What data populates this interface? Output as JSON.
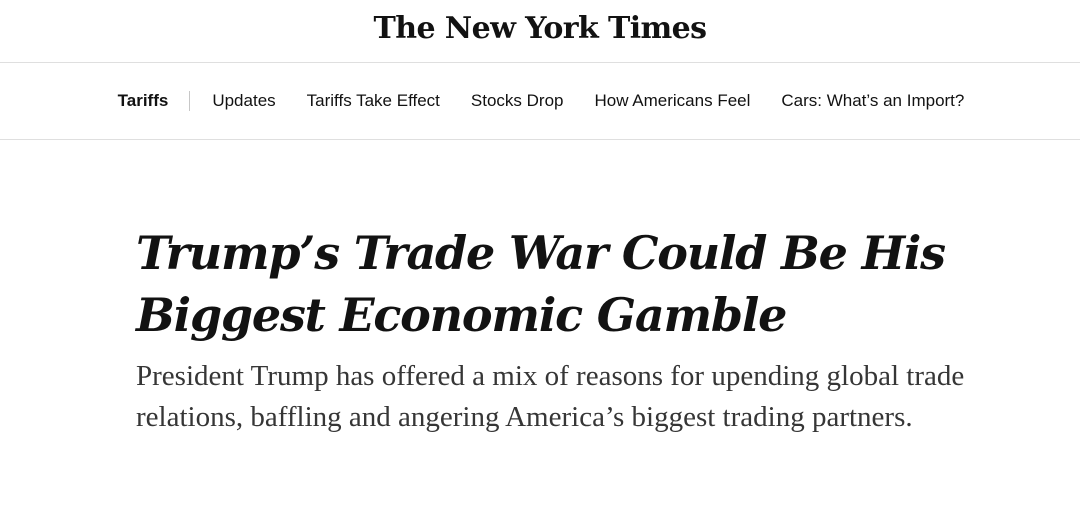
{
  "masthead": {
    "logo_text": "The New York Times"
  },
  "nav": {
    "primary": "Tariffs",
    "items": [
      {
        "label": "Updates"
      },
      {
        "label": "Tariffs Take Effect"
      },
      {
        "label": "Stocks Drop"
      },
      {
        "label": "How Americans Feel"
      },
      {
        "label": "Cars: What’s an Import?"
      }
    ]
  },
  "article": {
    "headline": "Trump’s Trade War Could Be His Biggest Economic Gamble",
    "summary": "President Trump has offered a mix of reasons for upending global trade relations, baffling and angering America’s biggest trading partners."
  }
}
